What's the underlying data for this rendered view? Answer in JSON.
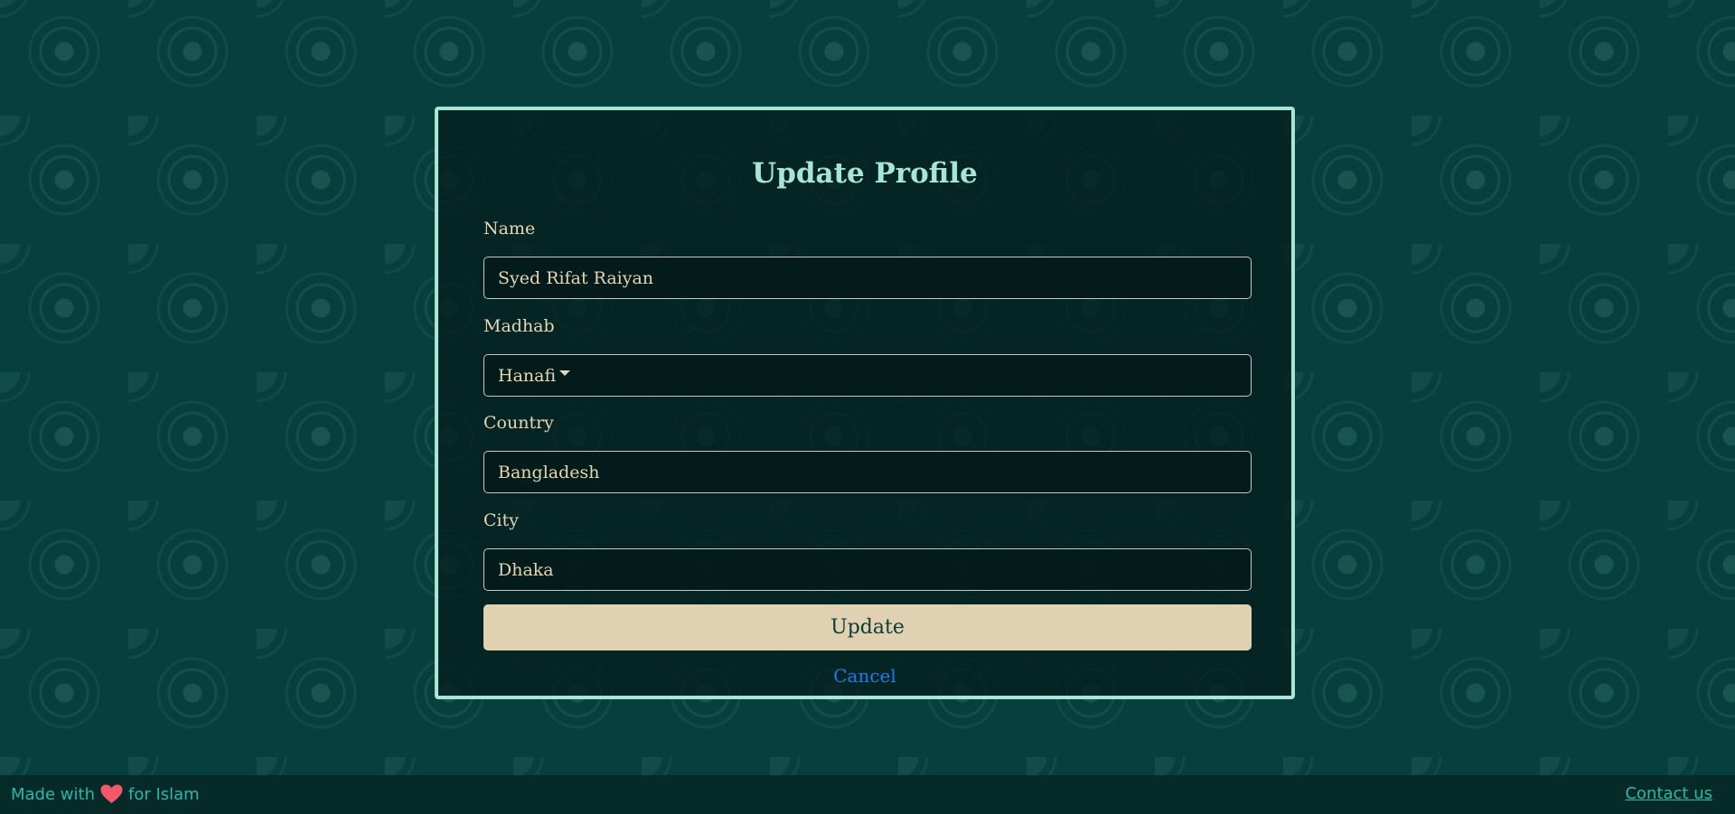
{
  "form": {
    "title": "Update Profile",
    "name_label": "Name",
    "name_value": "Syed Rifat Raiyan",
    "madhab_label": "Madhab",
    "madhab_value": "Hanafi",
    "country_label": "Country",
    "country_value": "Bangladesh",
    "city_label": "City",
    "city_value": "Dhaka",
    "update_label": "Update",
    "cancel_label": "Cancel"
  },
  "footer": {
    "made_with": "Made with",
    "for_islam": "for Islam",
    "contact": "Contact us"
  },
  "icons": {
    "heart": "heart-icon",
    "dropdown": "chevron-down-icon"
  },
  "colors": {
    "background": "#063f3d",
    "accent": "#a7e6d6",
    "text": "#e6d6b3",
    "button": "#e0d1b2",
    "link": "#1f7bf0",
    "footer_text": "#2bb8a8",
    "heart": "#f25a6a"
  }
}
